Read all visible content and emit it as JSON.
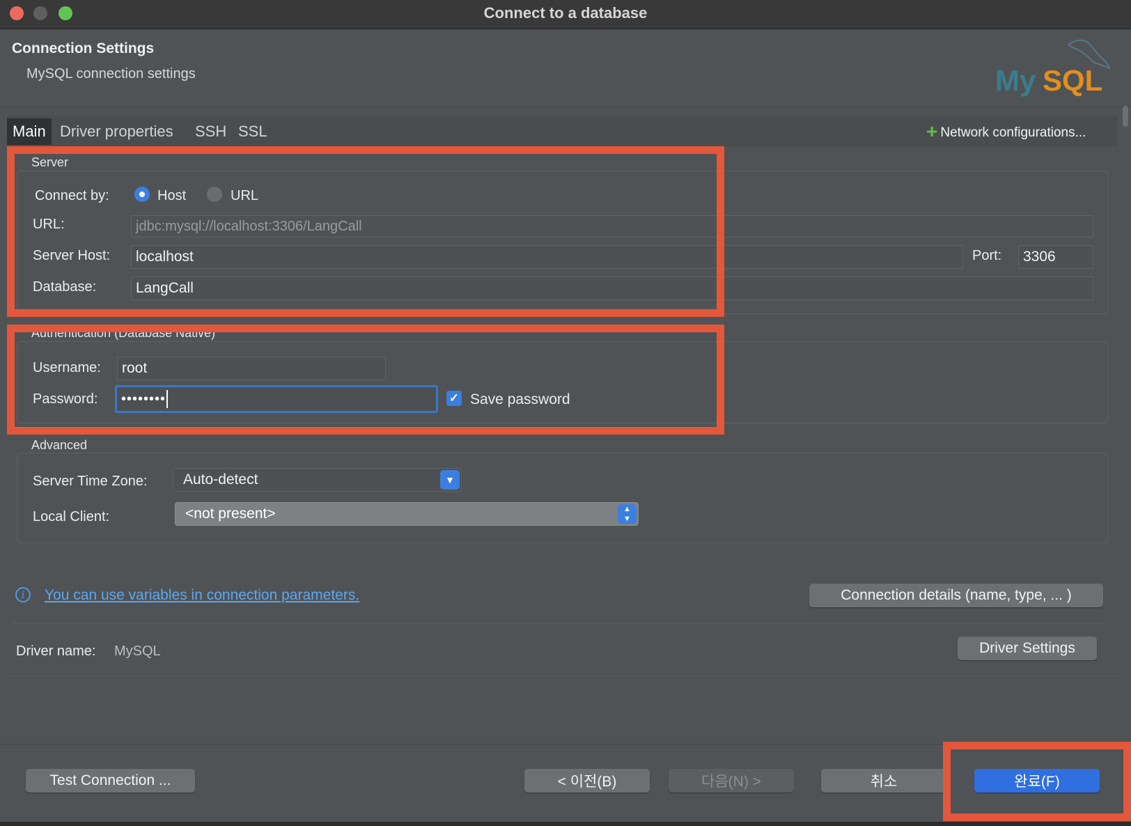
{
  "window": {
    "title": "Connect to a database"
  },
  "header": {
    "title": "Connection Settings",
    "subtitle": "MySQL connection settings",
    "logo_text": "MySQL"
  },
  "tabs": [
    {
      "label": "Main",
      "active": true
    },
    {
      "label": "Driver properties"
    },
    {
      "label": "SSH"
    },
    {
      "label": "SSL"
    }
  ],
  "network_config": {
    "label": "Network configurations..."
  },
  "server": {
    "group_label": "Server",
    "connect_by_label": "Connect by:",
    "connect_by_options": [
      "Host",
      "URL"
    ],
    "connect_by_selected": "Host",
    "url_label": "URL:",
    "url_value": "jdbc:mysql://localhost:3306/LangCall",
    "host_label": "Server Host:",
    "host_value": "localhost",
    "port_label": "Port:",
    "port_value": "3306",
    "database_label": "Database:",
    "database_value": "LangCall"
  },
  "auth": {
    "group_label": "Authentication (Database Native)",
    "username_label": "Username:",
    "username_value": "root",
    "password_label": "Password:",
    "password_value": "••••••••",
    "save_password_label": "Save password",
    "save_password_checked": true
  },
  "advanced": {
    "group_label": "Advanced",
    "timezone_label": "Server Time Zone:",
    "timezone_value": "Auto-detect",
    "local_client_label": "Local Client:",
    "local_client_value": "<not present>"
  },
  "info": {
    "link_text": "You can use variables in connection parameters."
  },
  "connection_details_button": "Connection details (name, type, ... )",
  "driver": {
    "label": "Driver name:",
    "value": "MySQL",
    "settings_button": "Driver Settings"
  },
  "footer": {
    "test_connection": "Test Connection ...",
    "back": "< 이전(B)",
    "next": "다음(N) >",
    "cancel": "취소",
    "finish": "완료(F)"
  },
  "colors": {
    "highlight": "#e4573b",
    "accent": "#3b7fe0",
    "link": "#5ba7ef"
  }
}
